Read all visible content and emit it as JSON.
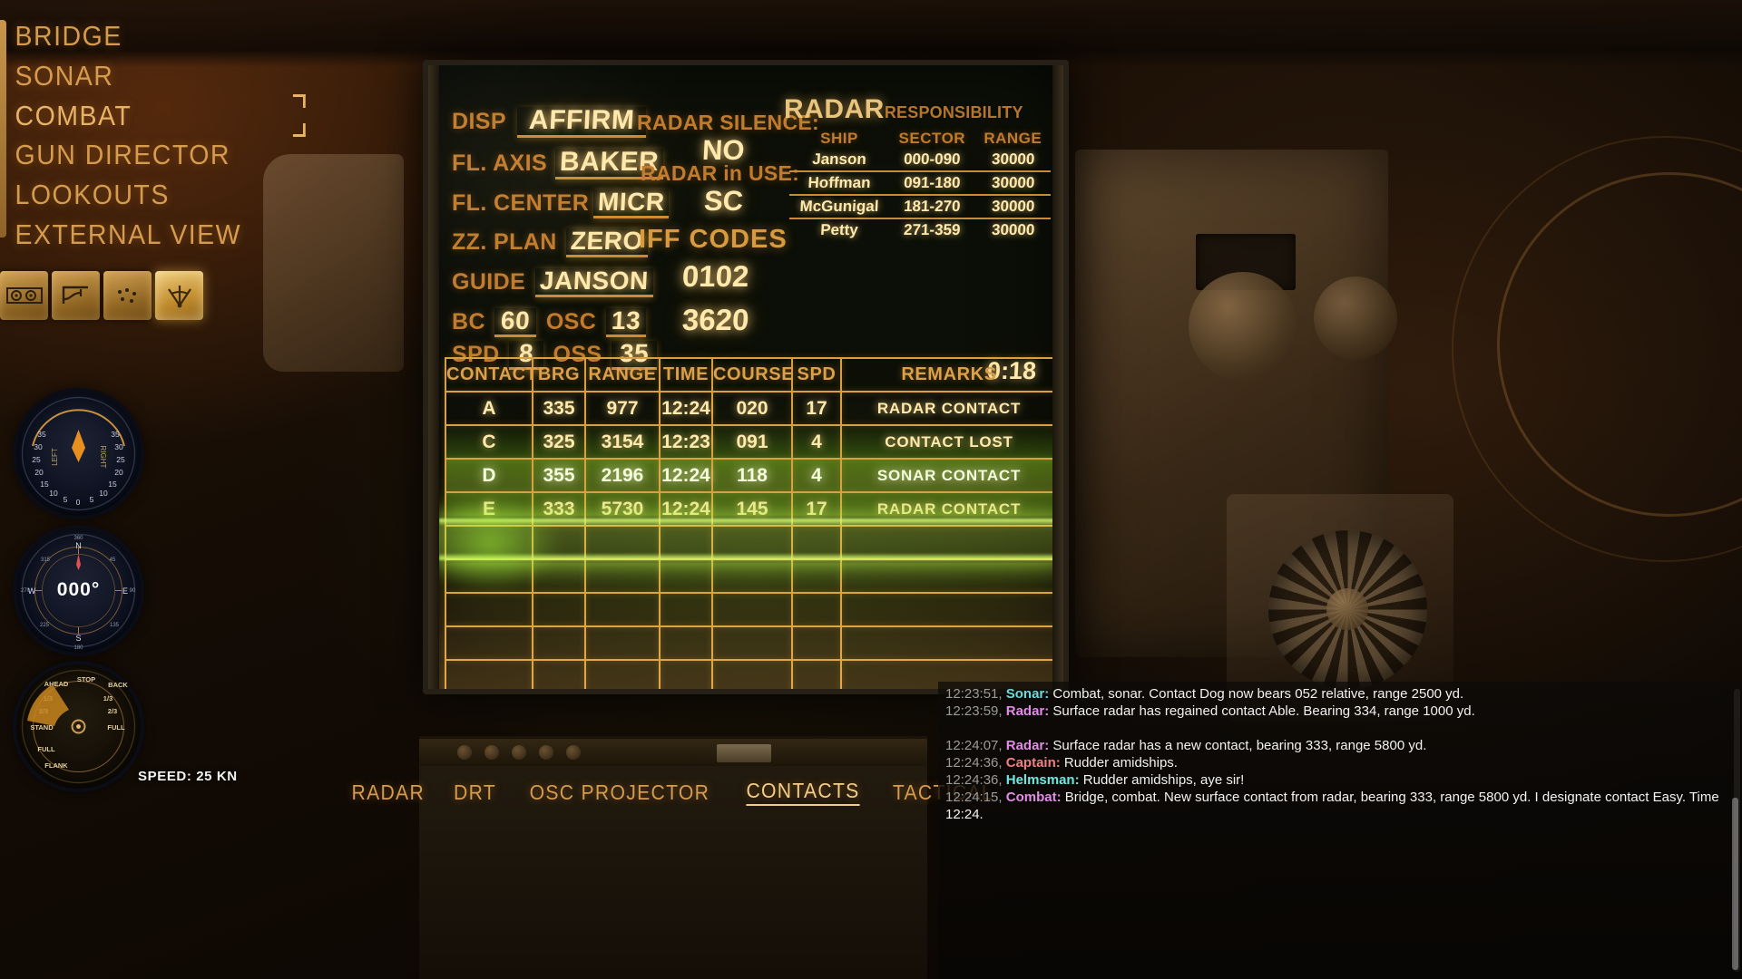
{
  "nav": {
    "items": [
      {
        "label": "BRIDGE",
        "active": false
      },
      {
        "label": "SONAR",
        "active": false
      },
      {
        "label": "COMBAT",
        "active": true
      },
      {
        "label": "GUN DIRECTOR",
        "active": false
      },
      {
        "label": "LOOKOUTS",
        "active": false
      },
      {
        "label": "EXTERNAL VIEW",
        "active": false
      }
    ]
  },
  "toolbar": {
    "items": [
      {
        "name": "dials-tool",
        "selected": false
      },
      {
        "name": "chart-tool",
        "selected": false
      },
      {
        "name": "plot-tool",
        "selected": false
      },
      {
        "name": "radar-sweep-tool",
        "selected": true
      }
    ]
  },
  "gauges": {
    "rudder": {
      "name": "rudder-angle-indicator",
      "left_label": "LEFT",
      "right_label": "RIGHT",
      "ticks": [
        "35",
        "30",
        "25",
        "20",
        "15",
        "10",
        "5",
        "0",
        "5",
        "10",
        "15",
        "20",
        "25",
        "30",
        "35"
      ],
      "value": 0
    },
    "compass": {
      "name": "gyro-compass",
      "heading": "000°",
      "cardinals": [
        "N",
        "E",
        "S",
        "W"
      ],
      "ticks": [
        "315",
        "45",
        "135",
        "225",
        "270",
        "90",
        "180",
        "360"
      ]
    },
    "telegraph": {
      "name": "engine-order-telegraph",
      "labels": [
        "AHEAD",
        "STOP",
        "BACK",
        "1/3",
        "2/3",
        "STAND",
        "FULL",
        "FLANK",
        "1/3",
        "2/3",
        "FULL"
      ],
      "setting": "STAND"
    },
    "speed_readout": "SPEED: 25 KN"
  },
  "board": {
    "form": {
      "disp": {
        "label": "DISP",
        "value": "AFFIRM"
      },
      "fl_axis": {
        "label": "FL. AXIS",
        "value": "BAKER"
      },
      "fl_center": {
        "label": "FL. CENTER",
        "value": "MICR"
      },
      "zz_plan": {
        "label": "ZZ. PLAN",
        "value": "ZERO"
      },
      "guide": {
        "label": "GUIDE",
        "value": "JANSON"
      },
      "bc": {
        "label": "BC",
        "value": "60"
      },
      "osc": {
        "label": "OSC",
        "value": "13"
      },
      "spd": {
        "label": "SPD",
        "value": "8"
      },
      "oss": {
        "label": "OSS",
        "value": "35"
      }
    },
    "radar_silence": {
      "label": "RADAR SILENCE:",
      "value": "NO"
    },
    "radar_in_use": {
      "label": "RADAR in USE:",
      "value": "SC"
    },
    "iff": {
      "title": "IFF CODES",
      "code1": "0102",
      "code2": "3620"
    },
    "clock": "0:18",
    "responsibility": {
      "title_main": "RADAR",
      "title_sub": "RESPONSIBILITY",
      "headers": [
        "SHIP",
        "SECTOR",
        "RANGE"
      ],
      "rows": [
        {
          "ship": "Janson",
          "sector": "000-090",
          "range": "30000"
        },
        {
          "ship": "Hoffman",
          "sector": "091-180",
          "range": "30000"
        },
        {
          "ship": "McGunigal",
          "sector": "181-270",
          "range": "30000"
        },
        {
          "ship": "Petty",
          "sector": "271-359",
          "range": "30000"
        }
      ]
    },
    "contacts": {
      "headers": [
        "CONTACT",
        "BRG",
        "RANGE",
        "TIME",
        "COURSE",
        "SPD",
        "REMARKS"
      ],
      "rows": [
        {
          "contact": "A",
          "brg": "335",
          "range": "977",
          "time": "12:24",
          "course": "020",
          "spd": "17",
          "remarks": "RADAR CONTACT",
          "highlight": "none"
        },
        {
          "contact": "C",
          "brg": "325",
          "range": "3154",
          "time": "12:23",
          "course": "091",
          "spd": "4",
          "remarks": "CONTACT LOST",
          "highlight": "glowA"
        },
        {
          "contact": "D",
          "brg": "355",
          "range": "2196",
          "time": "12:24",
          "course": "118",
          "spd": "4",
          "remarks": "SONAR CONTACT",
          "highlight": "glowB"
        },
        {
          "contact": "E",
          "brg": "333",
          "range": "5730",
          "time": "12:24",
          "course": "145",
          "spd": "17",
          "remarks": "RADAR CONTACT",
          "highlight": "glowC"
        },
        {
          "contact": "",
          "brg": "",
          "range": "",
          "time": "",
          "course": "",
          "spd": "",
          "remarks": "",
          "highlight": "none"
        },
        {
          "contact": "",
          "brg": "",
          "range": "",
          "time": "",
          "course": "",
          "spd": "",
          "remarks": "",
          "highlight": "none"
        },
        {
          "contact": "",
          "brg": "",
          "range": "",
          "time": "",
          "course": "",
          "spd": "",
          "remarks": "",
          "highlight": "none"
        },
        {
          "contact": "",
          "brg": "",
          "range": "",
          "time": "",
          "course": "",
          "spd": "",
          "remarks": "",
          "highlight": "none"
        },
        {
          "contact": "",
          "brg": "",
          "range": "",
          "time": "",
          "course": "",
          "spd": "",
          "remarks": "",
          "highlight": "none"
        }
      ]
    }
  },
  "tabs": {
    "items": [
      {
        "label": "RADAR",
        "active": false
      },
      {
        "label": "DRT",
        "active": false
      },
      {
        "label": "OSC PROJECTOR",
        "active": false
      },
      {
        "label": "CONTACTS",
        "active": true
      },
      {
        "label": "TACTICAL",
        "active": false
      }
    ]
  },
  "log": {
    "lines": [
      {
        "ts": "12:23:51,",
        "who": "Sonar:",
        "color": "#6fd8d8",
        "text": "Combat, sonar. Contact Dog now bears 052 relative, range 2500 yd."
      },
      {
        "ts": "12:23:59,",
        "who": "Radar:",
        "color": "#e28ce8",
        "text": "Surface radar has regained contact Able. Bearing 334, range 1000 yd."
      },
      {
        "ts": "",
        "who": "",
        "color": "#ffffff",
        "text": ""
      },
      {
        "ts": "12:24:07,",
        "who": "Radar:",
        "color": "#e28ce8",
        "text": "Surface radar has a new contact, bearing 333, range 5800 yd."
      },
      {
        "ts": "12:24:36,",
        "who": "Captain:",
        "color": "#f08080",
        "text": "Rudder amidships."
      },
      {
        "ts": "12:24:36,",
        "who": "Helmsman:",
        "color": "#6fe8e0",
        "text": "Rudder amidships, aye sir!"
      },
      {
        "ts": "12:24:15,",
        "who": "Combat:",
        "color": "#e28ce8",
        "text": "Bridge, combat. New surface contact from radar, bearing 333, range 5800 yd. I designate contact Easy. Time 12:24."
      }
    ]
  },
  "colors": {
    "amber": "#d59b4f",
    "amber_bright": "#ffe9ad",
    "amber_label": "#c07b2c",
    "green_glow": "#b6e83c",
    "grid": "#d9a043"
  }
}
